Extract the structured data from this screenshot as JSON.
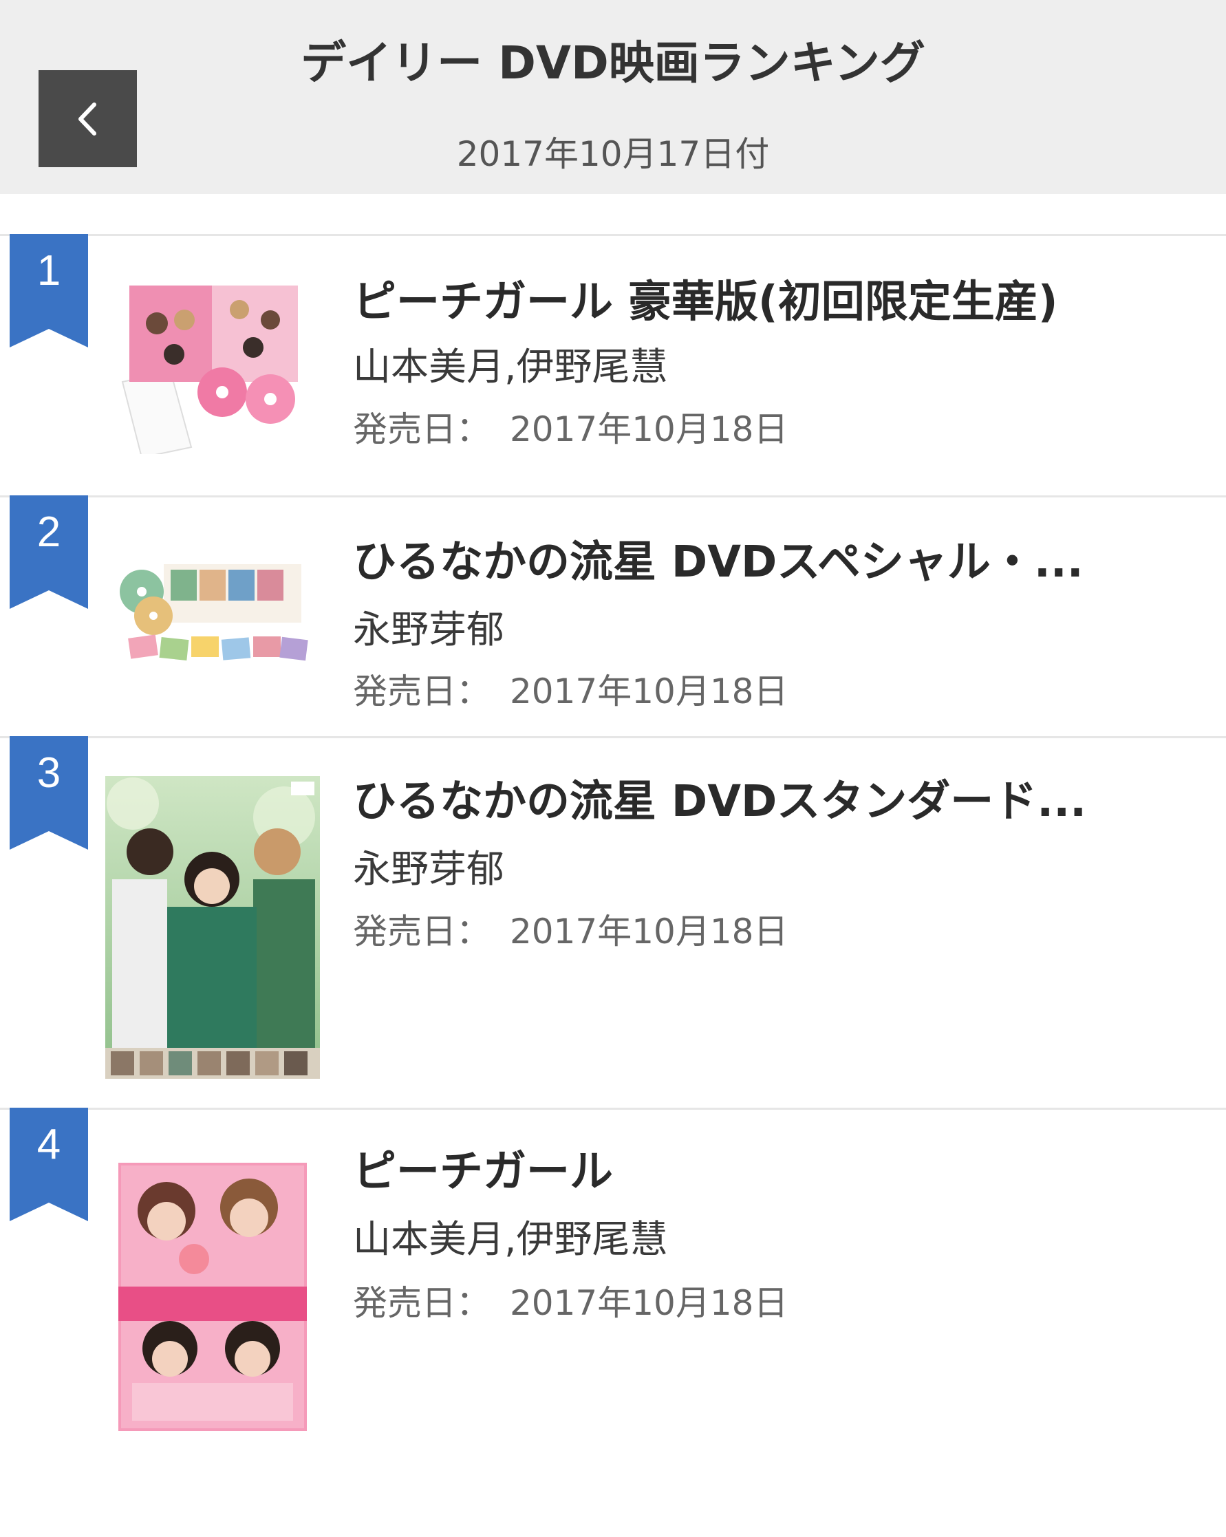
{
  "header": {
    "title": "デイリー DVD映画ランキング",
    "date": "2017年10月17日付",
    "back_icon": "chevron-left-icon"
  },
  "colors": {
    "header_bg": "#eeeeee",
    "back_button_bg": "#4a4a4a",
    "ribbon": "#3a73c4"
  },
  "release_label": "発売日：",
  "items": [
    {
      "rank": "1",
      "title": "ピーチガール 豪華版(初回限定生産)",
      "artist": "山本美月,伊野尾慧",
      "release_date": "2017年10月18日"
    },
    {
      "rank": "2",
      "title": "ひるなかの流星 DVDスペシャル・...",
      "artist": "永野芽郁",
      "release_date": "2017年10月18日"
    },
    {
      "rank": "3",
      "title": "ひるなかの流星 DVDスタンダード...",
      "artist": "永野芽郁",
      "release_date": "2017年10月18日"
    },
    {
      "rank": "4",
      "title": "ピーチガール",
      "artist": "山本美月,伊野尾慧",
      "release_date": "2017年10月18日"
    }
  ]
}
